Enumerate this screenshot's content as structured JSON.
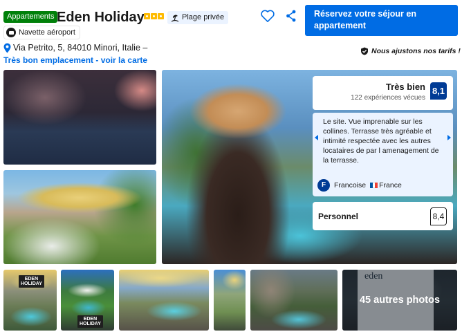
{
  "header": {
    "type_badge": "Appartements",
    "title": "Eden Holiday",
    "star_count": 3,
    "beach_badge": "Plage privée",
    "shuttle_badge": "Navette aéroport",
    "address": "Via Petrito, 5, 84010 Minori, Italie –",
    "map_link": "Très bon emplacement - voir la carte",
    "price_match": "Nous ajustons nos tarifs !",
    "cta_label": "Réservez votre séjour en appartement"
  },
  "icons": {
    "favorite": "heart-icon",
    "share": "share-icon",
    "location": "map-pin-icon",
    "beach": "beach-icon",
    "shuttle": "shuttle-icon",
    "price_match": "thumbs-up-icon"
  },
  "score": {
    "label": "Très bien",
    "count": "122 expériences vécues",
    "value": "8,1"
  },
  "review": {
    "text": "Le site. Vue imprenable sur les collines. Terrasse très agréable et intimité respectée avec les autres locataires de par l amenagement de la terrasse.",
    "avatar_letter": "F",
    "reviewer": "Francoise",
    "country": "France"
  },
  "staff": {
    "label": "Personnel",
    "value": "8,4"
  },
  "gallery": {
    "more_photos": "45 autres photos",
    "logo_line1": "EDEN",
    "logo_line2": "HOLIDAY",
    "sign_text": "eden"
  },
  "colors": {
    "brand_blue": "#006ce4",
    "dark_blue": "#003b95",
    "green": "#008009",
    "star_yellow": "#febb02",
    "light_blue_bg": "#ebf3ff"
  }
}
